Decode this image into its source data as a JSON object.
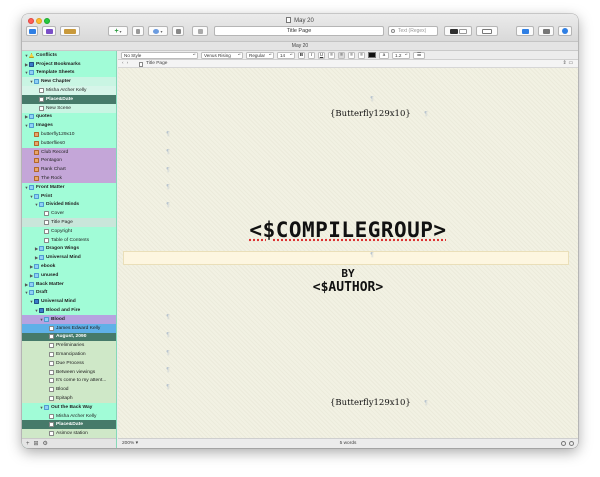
{
  "window": {
    "title": "May 20",
    "date_strip": "May 20"
  },
  "toolbar": {
    "title_field": "Title Page",
    "search_placeholder": "Text (Regex)"
  },
  "binder": {
    "items": [
      {
        "label": "Conflicts",
        "depth": 0,
        "disc": "▼",
        "icon": "warn",
        "bold": true,
        "bg": ""
      },
      {
        "label": "Project Bookmarks",
        "depth": 0,
        "disc": "▶",
        "icon": "book",
        "bold": true,
        "bg": ""
      },
      {
        "label": "Template Sheets",
        "depth": 0,
        "disc": "▼",
        "icon": "folder",
        "bold": true,
        "bg": ""
      },
      {
        "label": "New Chapter",
        "depth": 1,
        "disc": "▼",
        "icon": "folder",
        "bold": true,
        "bg": "#c9f5e3"
      },
      {
        "label": "Misha Archer Kelly",
        "depth": 2,
        "disc": "",
        "icon": "doc",
        "bold": false,
        "bg": "#d6f5e9"
      },
      {
        "label": "Place&Date",
        "depth": 2,
        "disc": "",
        "icon": "doc",
        "bold": true,
        "bg": "#467a6a",
        "fg": "#ffffff"
      },
      {
        "label": "New Scene",
        "depth": 2,
        "disc": "",
        "icon": "doc",
        "bold": false,
        "bg": "#c9f5e3"
      },
      {
        "label": "quotes",
        "depth": 0,
        "disc": "▶",
        "icon": "folder",
        "bold": true,
        "bg": ""
      },
      {
        "label": "Images",
        "depth": 0,
        "disc": "▼",
        "icon": "folder",
        "bold": true,
        "bg": ""
      },
      {
        "label": "butterfly129x10",
        "depth": 1,
        "disc": "",
        "icon": "img",
        "bold": false,
        "bg": ""
      },
      {
        "label": "butterflies0",
        "depth": 1,
        "disc": "",
        "icon": "img",
        "bold": false,
        "bg": ""
      },
      {
        "label": "Club Record",
        "depth": 1,
        "disc": "",
        "icon": "img",
        "bold": false,
        "bg": "#c4a6d8"
      },
      {
        "label": "Pentagon",
        "depth": 1,
        "disc": "",
        "icon": "img",
        "bold": false,
        "bg": "#c4a6d8"
      },
      {
        "label": "Rank Chart",
        "depth": 1,
        "disc": "",
        "icon": "img",
        "bold": false,
        "bg": "#c4a6d8"
      },
      {
        "label": "The Rock",
        "depth": 1,
        "disc": "",
        "icon": "img",
        "bold": false,
        "bg": "#c4a6d8"
      },
      {
        "label": "Front Matter",
        "depth": 0,
        "disc": "▼",
        "icon": "folder",
        "bold": true,
        "bg": ""
      },
      {
        "label": "Print",
        "depth": 1,
        "disc": "▼",
        "icon": "folder",
        "bold": true,
        "bg": ""
      },
      {
        "label": "Divided Minds",
        "depth": 2,
        "disc": "▼",
        "icon": "folder",
        "bold": true,
        "bg": ""
      },
      {
        "label": "Cover",
        "depth": 3,
        "disc": "",
        "icon": "doc",
        "bold": false,
        "bg": ""
      },
      {
        "label": "Title Page",
        "depth": 3,
        "disc": "",
        "icon": "doc",
        "bold": false,
        "bg": "#c9e6da"
      },
      {
        "label": "Copyright",
        "depth": 3,
        "disc": "",
        "icon": "doc",
        "bold": false,
        "bg": ""
      },
      {
        "label": "Table of Contents",
        "depth": 3,
        "disc": "",
        "icon": "doc",
        "bold": false,
        "bg": ""
      },
      {
        "label": "Dragon Wings",
        "depth": 2,
        "disc": "▶",
        "icon": "folder",
        "bold": true,
        "bg": ""
      },
      {
        "label": "Universal Mind",
        "depth": 2,
        "disc": "▶",
        "icon": "folder",
        "bold": true,
        "bg": ""
      },
      {
        "label": "ebook",
        "depth": 1,
        "disc": "▶",
        "icon": "folder",
        "bold": true,
        "bg": ""
      },
      {
        "label": "unused",
        "depth": 1,
        "disc": "▶",
        "icon": "folder",
        "bold": true,
        "bg": ""
      },
      {
        "label": "Back Matter",
        "depth": 0,
        "disc": "▶",
        "icon": "folder",
        "bold": true,
        "bg": ""
      },
      {
        "label": "Draft",
        "depth": 0,
        "disc": "▼",
        "icon": "folder",
        "bold": true,
        "bg": ""
      },
      {
        "label": "Universal Mind",
        "depth": 1,
        "disc": "▼",
        "icon": "book",
        "bold": true,
        "bg": ""
      },
      {
        "label": "Blood and Fire",
        "depth": 2,
        "disc": "▼",
        "icon": "book",
        "bold": true,
        "bg": ""
      },
      {
        "label": "Blood",
        "depth": 3,
        "disc": "▼",
        "icon": "folder",
        "bold": true,
        "bg": "#b6a3e0"
      },
      {
        "label": "James Edward Kelly",
        "depth": 4,
        "disc": "",
        "icon": "doc",
        "bold": false,
        "bg": "#5fb0e8"
      },
      {
        "label": "August, 2090",
        "depth": 4,
        "disc": "",
        "icon": "doc",
        "bold": true,
        "bg": "#467a6a",
        "fg": "#ffffff"
      },
      {
        "label": "Preliminaries",
        "depth": 4,
        "disc": "",
        "icon": "doc",
        "bold": false,
        "bg": "#cfe8c8"
      },
      {
        "label": "Emancipation",
        "depth": 4,
        "disc": "",
        "icon": "doc",
        "bold": false,
        "bg": "#cfe8c8"
      },
      {
        "label": "Due Process",
        "depth": 4,
        "disc": "",
        "icon": "doc",
        "bold": false,
        "bg": "#cfe8c8"
      },
      {
        "label": "Between viewings",
        "depth": 4,
        "disc": "",
        "icon": "doc",
        "bold": false,
        "bg": "#cfe8c8"
      },
      {
        "label": "It's come to my attent...",
        "depth": 4,
        "disc": "",
        "icon": "doc",
        "bold": false,
        "bg": "#cfe8c8"
      },
      {
        "label": "Blood",
        "depth": 4,
        "disc": "",
        "icon": "doc",
        "bold": false,
        "bg": "#cfe8c8"
      },
      {
        "label": "Epitaph",
        "depth": 4,
        "disc": "",
        "icon": "doc",
        "bold": false,
        "bg": "#cfe8c8"
      },
      {
        "label": "Out the Back Way",
        "depth": 3,
        "disc": "▼",
        "icon": "folder",
        "bold": true,
        "bg": ""
      },
      {
        "label": "Misha Archer Kelly",
        "depth": 4,
        "disc": "",
        "icon": "doc",
        "bold": false,
        "bg": ""
      },
      {
        "label": "Place&Date",
        "depth": 4,
        "disc": "",
        "icon": "doc",
        "bold": true,
        "bg": "#467a6a",
        "fg": "#ffffff"
      },
      {
        "label": "Asimov station",
        "depth": 4,
        "disc": "",
        "icon": "doc",
        "bold": false,
        "bg": "#cfe8c8"
      }
    ]
  },
  "format_bar": {
    "style": "No Style",
    "font": "Venus Rising",
    "weight": "Regular",
    "size": "14",
    "bold": "B",
    "italic": "I",
    "underline": "U",
    "line_spacing": "1.2"
  },
  "header": {
    "title": "Title Page"
  },
  "editor": {
    "pilcrow": "¶",
    "header_image": "{Butterfly129x10}",
    "compile_group": "<$COMPILEGROUP>",
    "by": "BY",
    "author": "<$AUTHOR>",
    "footer_image": "{Butterfly129x10}"
  },
  "footer": {
    "zoom": "200%",
    "word_count": "5 words"
  },
  "colors": {
    "binder_bg": "#a1fcd7",
    "editor_bg": "#f2f1e3"
  }
}
